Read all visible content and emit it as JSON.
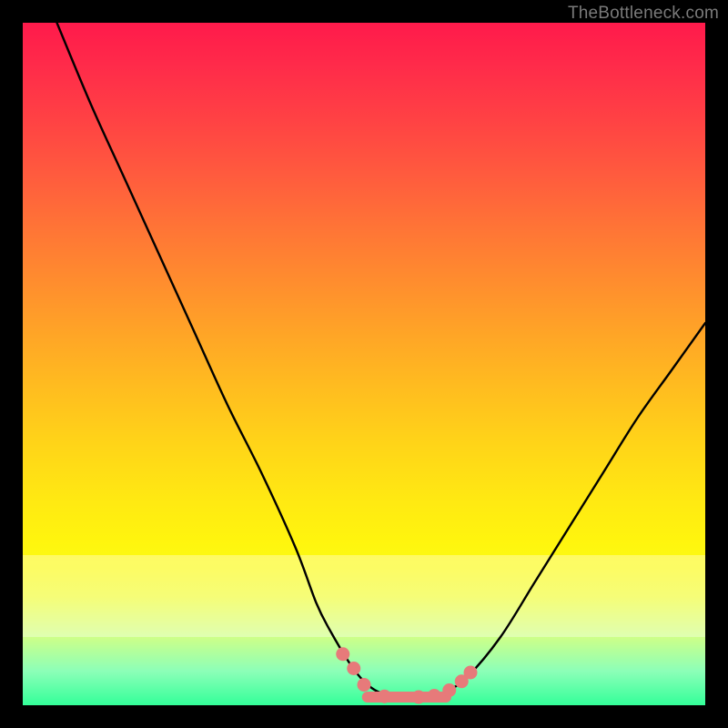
{
  "watermark": "TheBottleneck.com",
  "chart_data": {
    "type": "line",
    "title": "",
    "xlabel": "",
    "ylabel": "",
    "xlim": [
      0,
      100
    ],
    "ylim": [
      0,
      100
    ],
    "grid": false,
    "legend": false,
    "series": [
      {
        "name": "bottleneck-curve",
        "x": [
          5,
          10,
          15,
          20,
          25,
          30,
          35,
          40,
          43,
          45,
          48,
          50,
          52,
          55,
          57,
          60,
          62,
          65,
          70,
          75,
          80,
          85,
          90,
          95,
          100
        ],
        "y": [
          100,
          88,
          77,
          66,
          55,
          44,
          34,
          23,
          15,
          11,
          6,
          3.5,
          2,
          1,
          1,
          1,
          2,
          4,
          10,
          18,
          26,
          34,
          42,
          49,
          56
        ]
      }
    ],
    "markers": {
      "name": "highlight-dots",
      "x": [
        46.9,
        48.5,
        50.0,
        53.0,
        58.0,
        60.3,
        62.5,
        64.3,
        65.6
      ],
      "y": [
        7.5,
        5.4,
        3.0,
        1.3,
        1.2,
        1.4,
        2.2,
        3.5,
        4.8
      ]
    },
    "flat_segment": {
      "x_start": 50.5,
      "x_end": 62.0,
      "y": 1.2
    },
    "pale_band": {
      "y_top": 22,
      "y_bottom": 10
    }
  }
}
